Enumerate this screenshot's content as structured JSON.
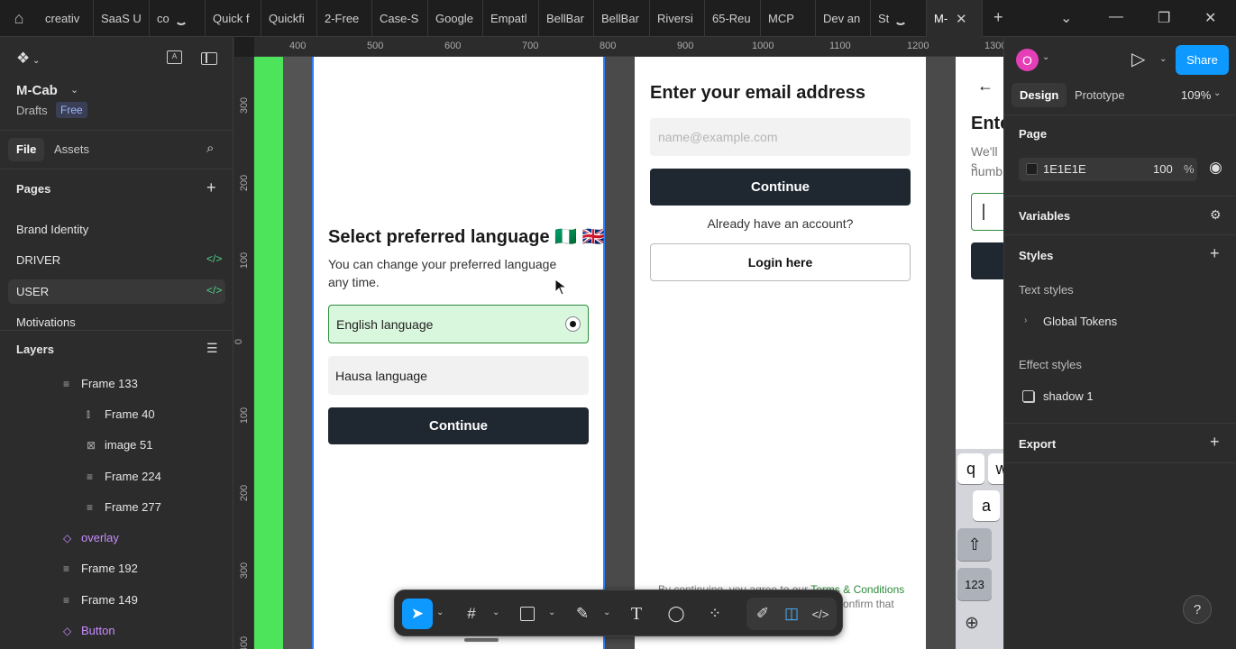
{
  "tabs": [
    {
      "label": "creativ"
    },
    {
      "label": "SaaS U"
    },
    {
      "label": "co"
    },
    {
      "label": "Quick f"
    },
    {
      "label": "Quickfi"
    },
    {
      "label": "2-Free"
    },
    {
      "label": "Case-S"
    },
    {
      "label": "Google"
    },
    {
      "label": "Empatl"
    },
    {
      "label": "BellBar"
    },
    {
      "label": "BellBar"
    },
    {
      "label": "Riversi"
    },
    {
      "label": "65-Reu"
    },
    {
      "label": "MCP"
    },
    {
      "label": "Dev an"
    },
    {
      "label": "St"
    },
    {
      "label": "M-"
    }
  ],
  "file": {
    "name": "M-Cab",
    "location": "Drafts",
    "plan": "Free"
  },
  "left_tabs": {
    "file": "File",
    "assets": "Assets"
  },
  "pages": {
    "heading": "Pages",
    "items": [
      {
        "label": "Brand Identity"
      },
      {
        "label": "DRIVER"
      },
      {
        "label": "USER"
      },
      {
        "label": "Motivations"
      }
    ]
  },
  "layers": {
    "heading": "Layers",
    "items": [
      {
        "label": "Frame 133"
      },
      {
        "label": "Frame 40"
      },
      {
        "label": "image 51"
      },
      {
        "label": "Frame 224"
      },
      {
        "label": "Frame 277"
      },
      {
        "label": "overlay"
      },
      {
        "label": "Frame 192"
      },
      {
        "label": "Frame 149"
      },
      {
        "label": "Button"
      }
    ]
  },
  "ruler": {
    "top": [
      "400",
      "500",
      "600",
      "700",
      "800",
      "900",
      "1000",
      "1100",
      "1200",
      "1300"
    ],
    "left": [
      "300",
      "200",
      "100",
      "0",
      "100",
      "200",
      "300",
      "400"
    ]
  },
  "screen_language": {
    "title": "Select preferred language",
    "flags": "🇳🇬 🇬🇧",
    "subtitle": "You can change your preferred language any time.",
    "option1": "English language",
    "option2": "Hausa language",
    "continue": "Continue"
  },
  "screen_email": {
    "title": "Enter your email address",
    "placeholder": "name@example.com",
    "continue": "Continue",
    "have_account": "Already have an account?",
    "login": "Login here",
    "legal_prefix": "By continuing, you agree to our ",
    "legal_link": "Terms & Conditions",
    "legal_line2": "confirm that"
  },
  "screen_phone": {
    "title": "Ente",
    "line1": "We'll s",
    "line2": "numb",
    "keys": {
      "q": "q",
      "w": "w",
      "a": "a",
      "num": "123"
    }
  },
  "right_panel": {
    "avatar": "O",
    "share": "Share",
    "tab_design": "Design",
    "tab_prototype": "Prototype",
    "zoom": "109%",
    "page_heading": "Page",
    "page_color": "1E1E1E",
    "page_opacity": "100",
    "percent": "%",
    "variables": "Variables",
    "styles": "Styles",
    "text_styles": "Text styles",
    "global_tokens": "Global Tokens",
    "effect_styles": "Effect styles",
    "shadow": "shadow 1",
    "export": "Export"
  },
  "help": "?",
  "colors": {
    "accent": "#0d99ff",
    "selection": "#2d7ff9",
    "option_selected_bg": "#d9f7dd",
    "option_selected_border": "#2e8b3c",
    "button_dark": "#1f2730",
    "green_bar": "#4de35a",
    "avatar": "#e43fb7"
  }
}
